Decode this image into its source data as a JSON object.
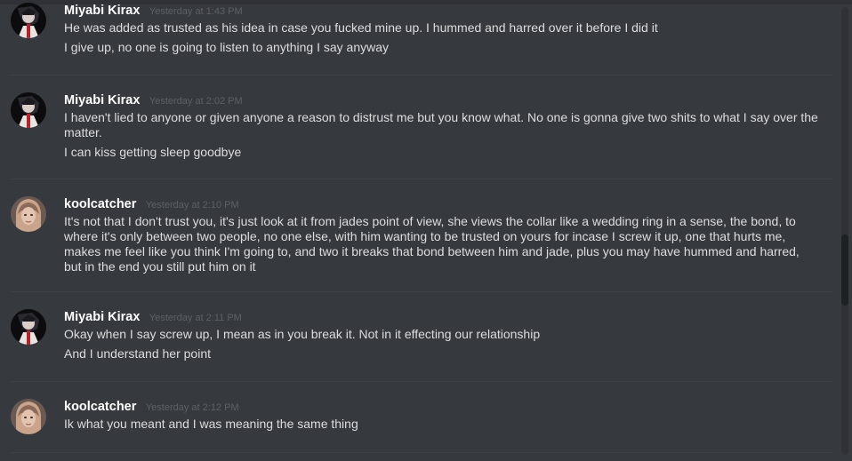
{
  "messages": [
    {
      "username": "Miyabi Kirax",
      "timestamp": "Yesterday at 1:43 PM",
      "avatar": "miyabi-avatar",
      "lines": [
        "He was added as trusted as his idea in case you fucked mine up.  I hummed and harred over it before I did it",
        "I give up,  no one is going to listen to anything I say anyway"
      ]
    },
    {
      "username": "Miyabi Kirax",
      "timestamp": "Yesterday at 2:02 PM",
      "avatar": "miyabi-avatar",
      "lines": [
        "I haven't lied to anyone or given anyone a reason to distrust me but you know what. No one is gonna give two shits to what I say over the matter.",
        "I can kiss getting sleep goodbye"
      ]
    },
    {
      "username": "koolcatcher",
      "timestamp": "Yesterday at 2:10 PM",
      "avatar": "koolcatcher-avatar",
      "lines": [
        "It's not that I don't trust you, it's just look at it from jades point of view, she views the collar like a wedding ring in a sense, the bond, to where it's only between two people, no one else, with him wanting to be trusted on yours for incase I screw it up, one that hurts me, makes me feel like you think I'm going to, and two it breaks that bond between him and jade, plus you may have hummed and harred, but in the end you still put him on it"
      ]
    },
    {
      "username": "Miyabi Kirax",
      "timestamp": "Yesterday at 2:11 PM",
      "avatar": "miyabi-avatar",
      "lines": [
        "Okay when I say screw up, I mean as in you break it. Not in it effecting our relationship",
        "And I understand her point"
      ]
    },
    {
      "username": "koolcatcher",
      "timestamp": "Yesterday at 2:12 PM",
      "avatar": "koolcatcher-avatar",
      "lines": [
        "Ik what you meant and I was meaning the same thing"
      ]
    }
  ],
  "colors": {
    "background": "#36393e",
    "username": "#ffffff",
    "timestamp": "#5d6066",
    "text": "#dcddde",
    "divider": "#3e4146"
  }
}
